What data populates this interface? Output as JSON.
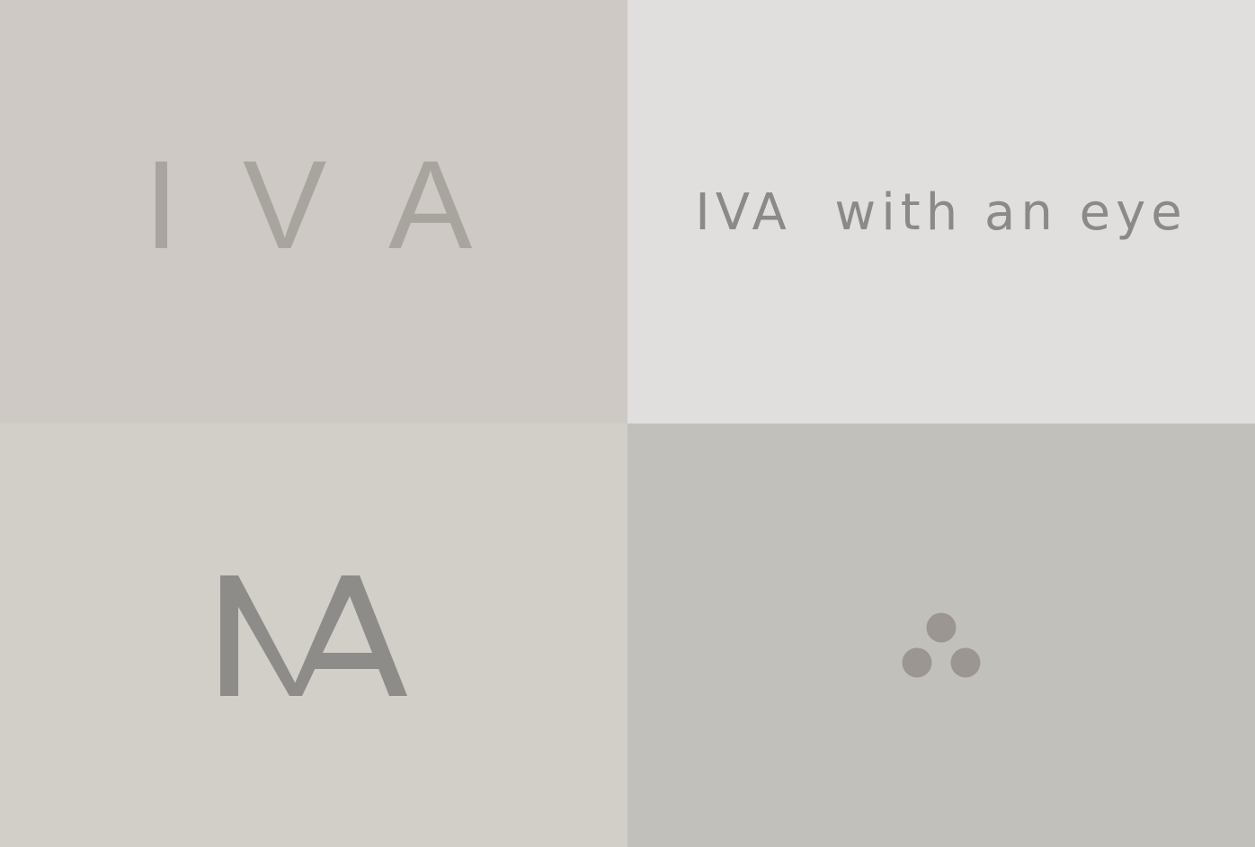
{
  "panels": [
    {
      "background": "#cec9c5",
      "color": "#a8a59f",
      "letters": [
        "I",
        "V",
        "A"
      ]
    },
    {
      "background": "#e0dfdd",
      "color": "#8c8a87",
      "wordmark": "IVA  with an eye"
    },
    {
      "background": "#d2cec8",
      "color": "#8d8c89",
      "monogram": "IVA"
    },
    {
      "background": "#c1c0bb",
      "color": "#9b9692",
      "icon": "three-dots-icon"
    }
  ]
}
